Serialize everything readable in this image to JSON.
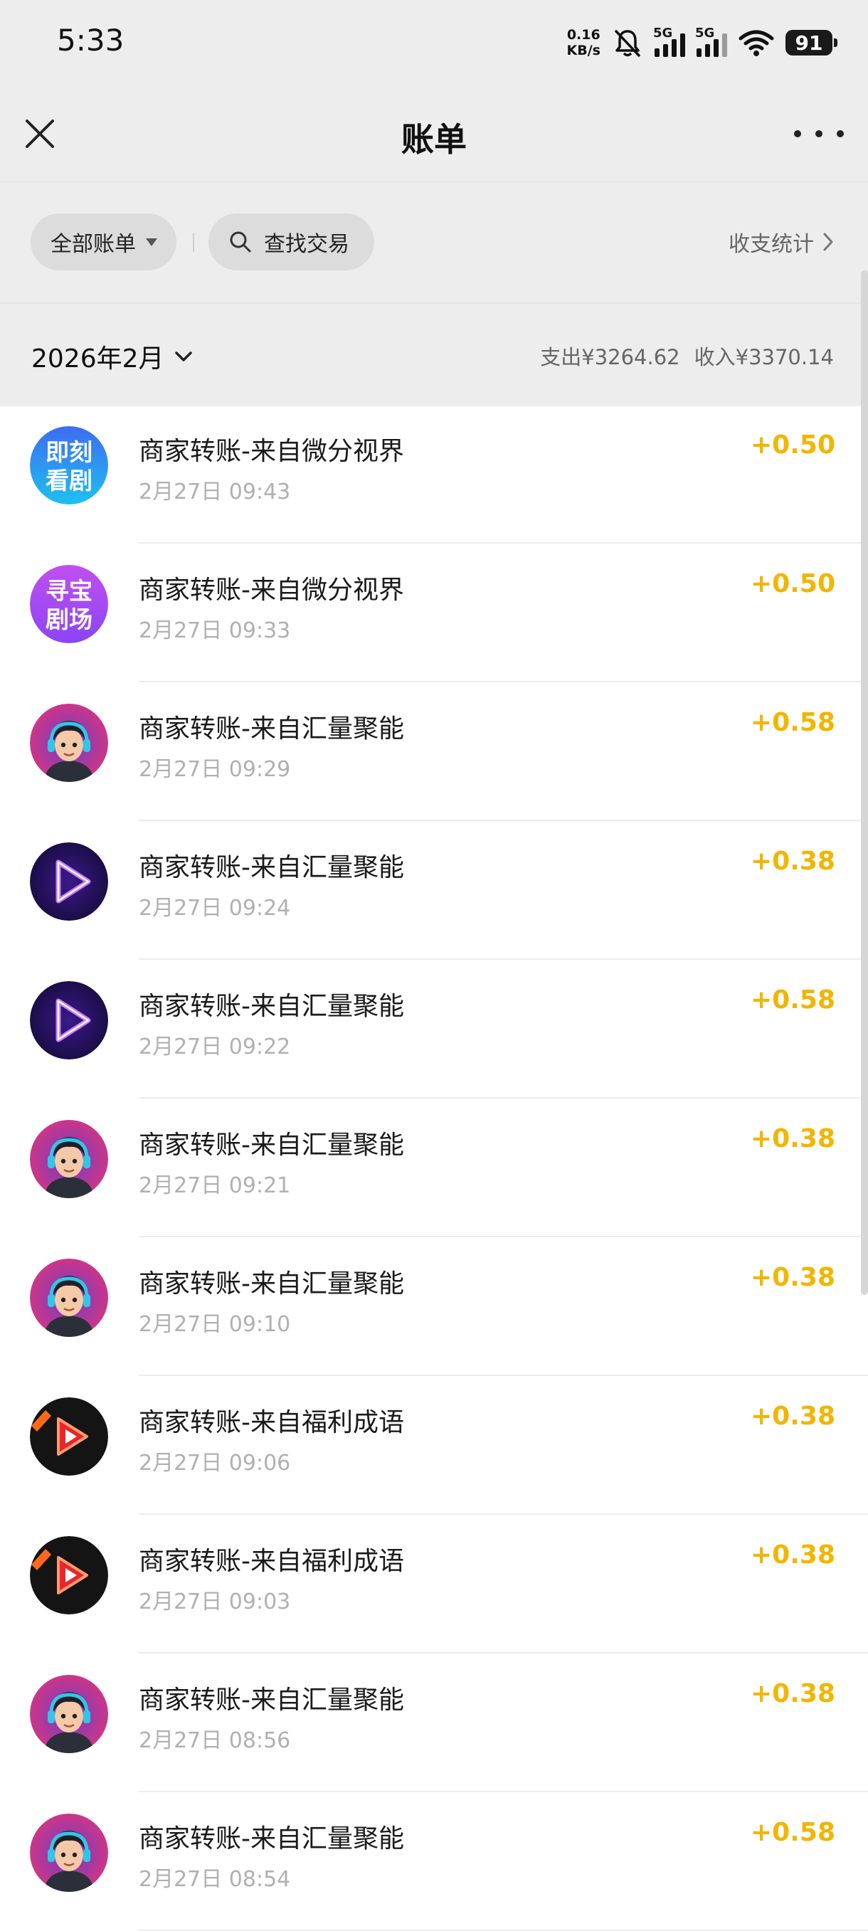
{
  "status_bar": {
    "time": "5:33",
    "net_speed_value": "0.16",
    "net_speed_unit": "KB/s",
    "signal1_label": "5G",
    "signal2_label": "5G",
    "battery": "91",
    "icons": [
      "bell-muted-icon",
      "signal-icon",
      "signal-icon",
      "wifi-icon",
      "battery-icon"
    ]
  },
  "header": {
    "title": "账单",
    "close_icon": "close-icon",
    "more_icon": "more-icon"
  },
  "filters": {
    "all_bills": "全部账单",
    "search": "查找交易",
    "stats": "收支统计"
  },
  "month": {
    "label": "2026年2月",
    "expense": "支出¥3264.62",
    "income": "收入¥3370.14"
  },
  "colors": {
    "accent_amount": "#f2b500",
    "background_gray": "#ededed"
  },
  "transactions": [
    {
      "title": "商家转账-来自微分视界",
      "time": "2月27日 09:43",
      "amount": "+0.50",
      "avatar": "jike-kanju",
      "avatar_text": [
        "即刻",
        "看剧"
      ]
    },
    {
      "title": "商家转账-来自微分视界",
      "time": "2月27日 09:33",
      "amount": "+0.50",
      "avatar": "xunbao-juchang",
      "avatar_text": [
        "寻宝",
        "剧场"
      ]
    },
    {
      "title": "商家转账-来自汇量聚能",
      "time": "2月27日 09:29",
      "amount": "+0.58",
      "avatar": "boy-headphones"
    },
    {
      "title": "商家转账-来自汇量聚能",
      "time": "2月27日 09:24",
      "amount": "+0.38",
      "avatar": "neon-play"
    },
    {
      "title": "商家转账-来自汇量聚能",
      "time": "2月27日 09:22",
      "amount": "+0.58",
      "avatar": "neon-play"
    },
    {
      "title": "商家转账-来自汇量聚能",
      "time": "2月27日 09:21",
      "amount": "+0.38",
      "avatar": "boy-headphones"
    },
    {
      "title": "商家转账-来自汇量聚能",
      "time": "2月27日 09:10",
      "amount": "+0.38",
      "avatar": "boy-headphones"
    },
    {
      "title": "商家转账-来自福利成语",
      "time": "2月27日 09:06",
      "amount": "+0.38",
      "avatar": "red-play"
    },
    {
      "title": "商家转账-来自福利成语",
      "time": "2月27日 09:03",
      "amount": "+0.38",
      "avatar": "red-play"
    },
    {
      "title": "商家转账-来自汇量聚能",
      "time": "2月27日 08:56",
      "amount": "+0.38",
      "avatar": "boy-headphones"
    },
    {
      "title": "商家转账-来自汇量聚能",
      "time": "2月27日 08:54",
      "amount": "+0.58",
      "avatar": "boy-headphones"
    }
  ]
}
